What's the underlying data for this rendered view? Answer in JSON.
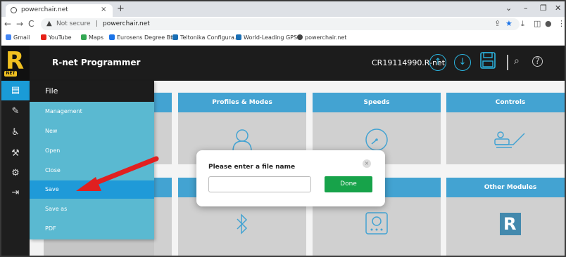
{
  "browser": {
    "tab_title": "powerchair.net",
    "close_tab": "×",
    "new_tab": "+",
    "address": {
      "security_label": "Not secure",
      "separator": "|",
      "url": "powerchair.net"
    },
    "bookmarks": [
      {
        "label": "Gmail",
        "color": "#4285f4"
      },
      {
        "label": "YouTube",
        "color": "#e62117"
      },
      {
        "label": "Maps",
        "color": "#34a853"
      },
      {
        "label": "Eurosens Degree Bt...",
        "color": "#1a73e8"
      },
      {
        "label": "Teltonika Configura...",
        "color": "#1a6fb5"
      },
      {
        "label": "World-Leading GPS...",
        "color": "#1a6fb5"
      },
      {
        "label": "powerchair.net",
        "color": "#444444"
      }
    ]
  },
  "app": {
    "title": "R-net Programmer",
    "logo_letter": "R",
    "logo_badge": "NET",
    "filename": "CR19114990.R-net",
    "accent_color": "#1a9bd7"
  },
  "file_menu": {
    "header": "File",
    "items": [
      "Management",
      "New",
      "Open",
      "Close",
      "Save",
      "Save as",
      "PDF"
    ],
    "selected": "Save"
  },
  "tiles": [
    {
      "label": "Profiles & Modes"
    },
    {
      "label": "Speeds"
    },
    {
      "label": "Controls"
    },
    {
      "label": "Other Modules"
    }
  ],
  "dialog": {
    "title": "Please enter a file name",
    "input_value": "",
    "done_label": "Done",
    "close_glyph": "×"
  }
}
